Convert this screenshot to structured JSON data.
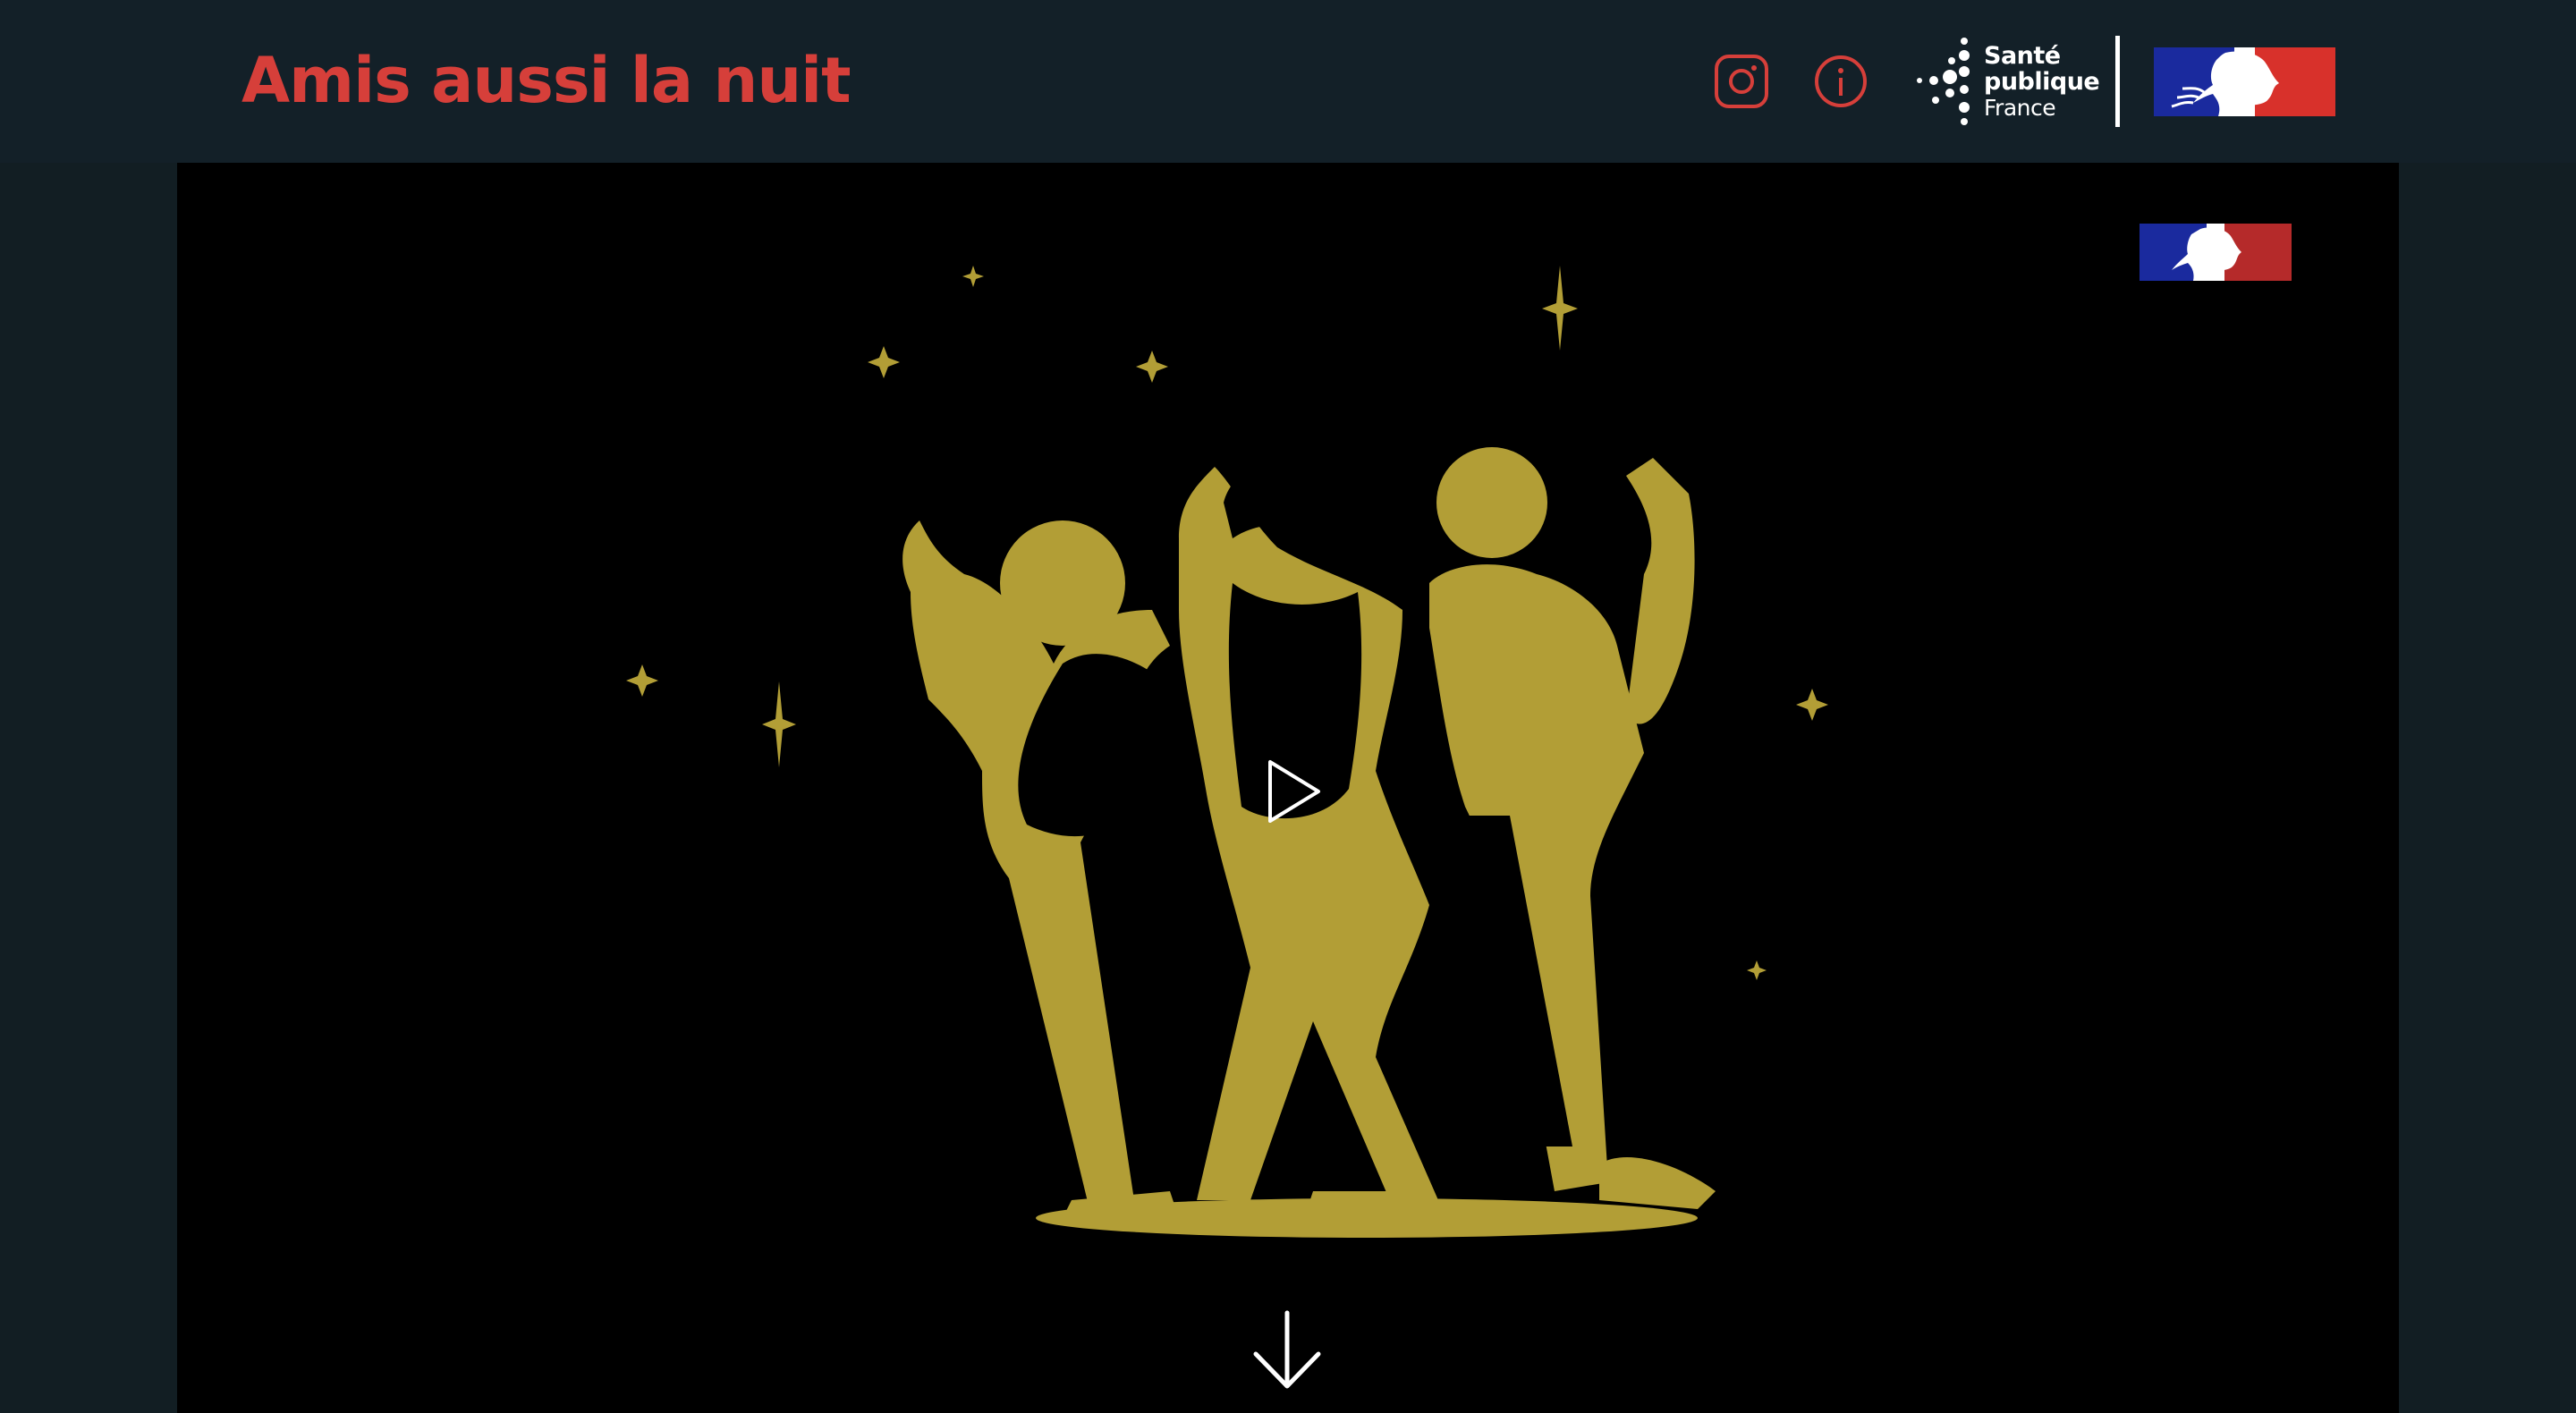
{
  "header": {
    "title": "Amis aussi la nuit",
    "icons": [
      "instagram-icon",
      "info-icon"
    ],
    "partner_logo": {
      "lines": [
        "Santé",
        "publique",
        "France"
      ]
    },
    "republic_logo": "marianne-logo"
  },
  "video": {
    "play_icon": "play-icon",
    "scroll_icon": "arrow-down-icon"
  },
  "colors": {
    "accent": "#d63f3a",
    "header_bg": "#132028",
    "page_bg": "#121e23",
    "video_bg": "#000000",
    "illustration": "#b29e36",
    "flag_blue": "#1a2a9e",
    "flag_red": "#d8312b"
  }
}
